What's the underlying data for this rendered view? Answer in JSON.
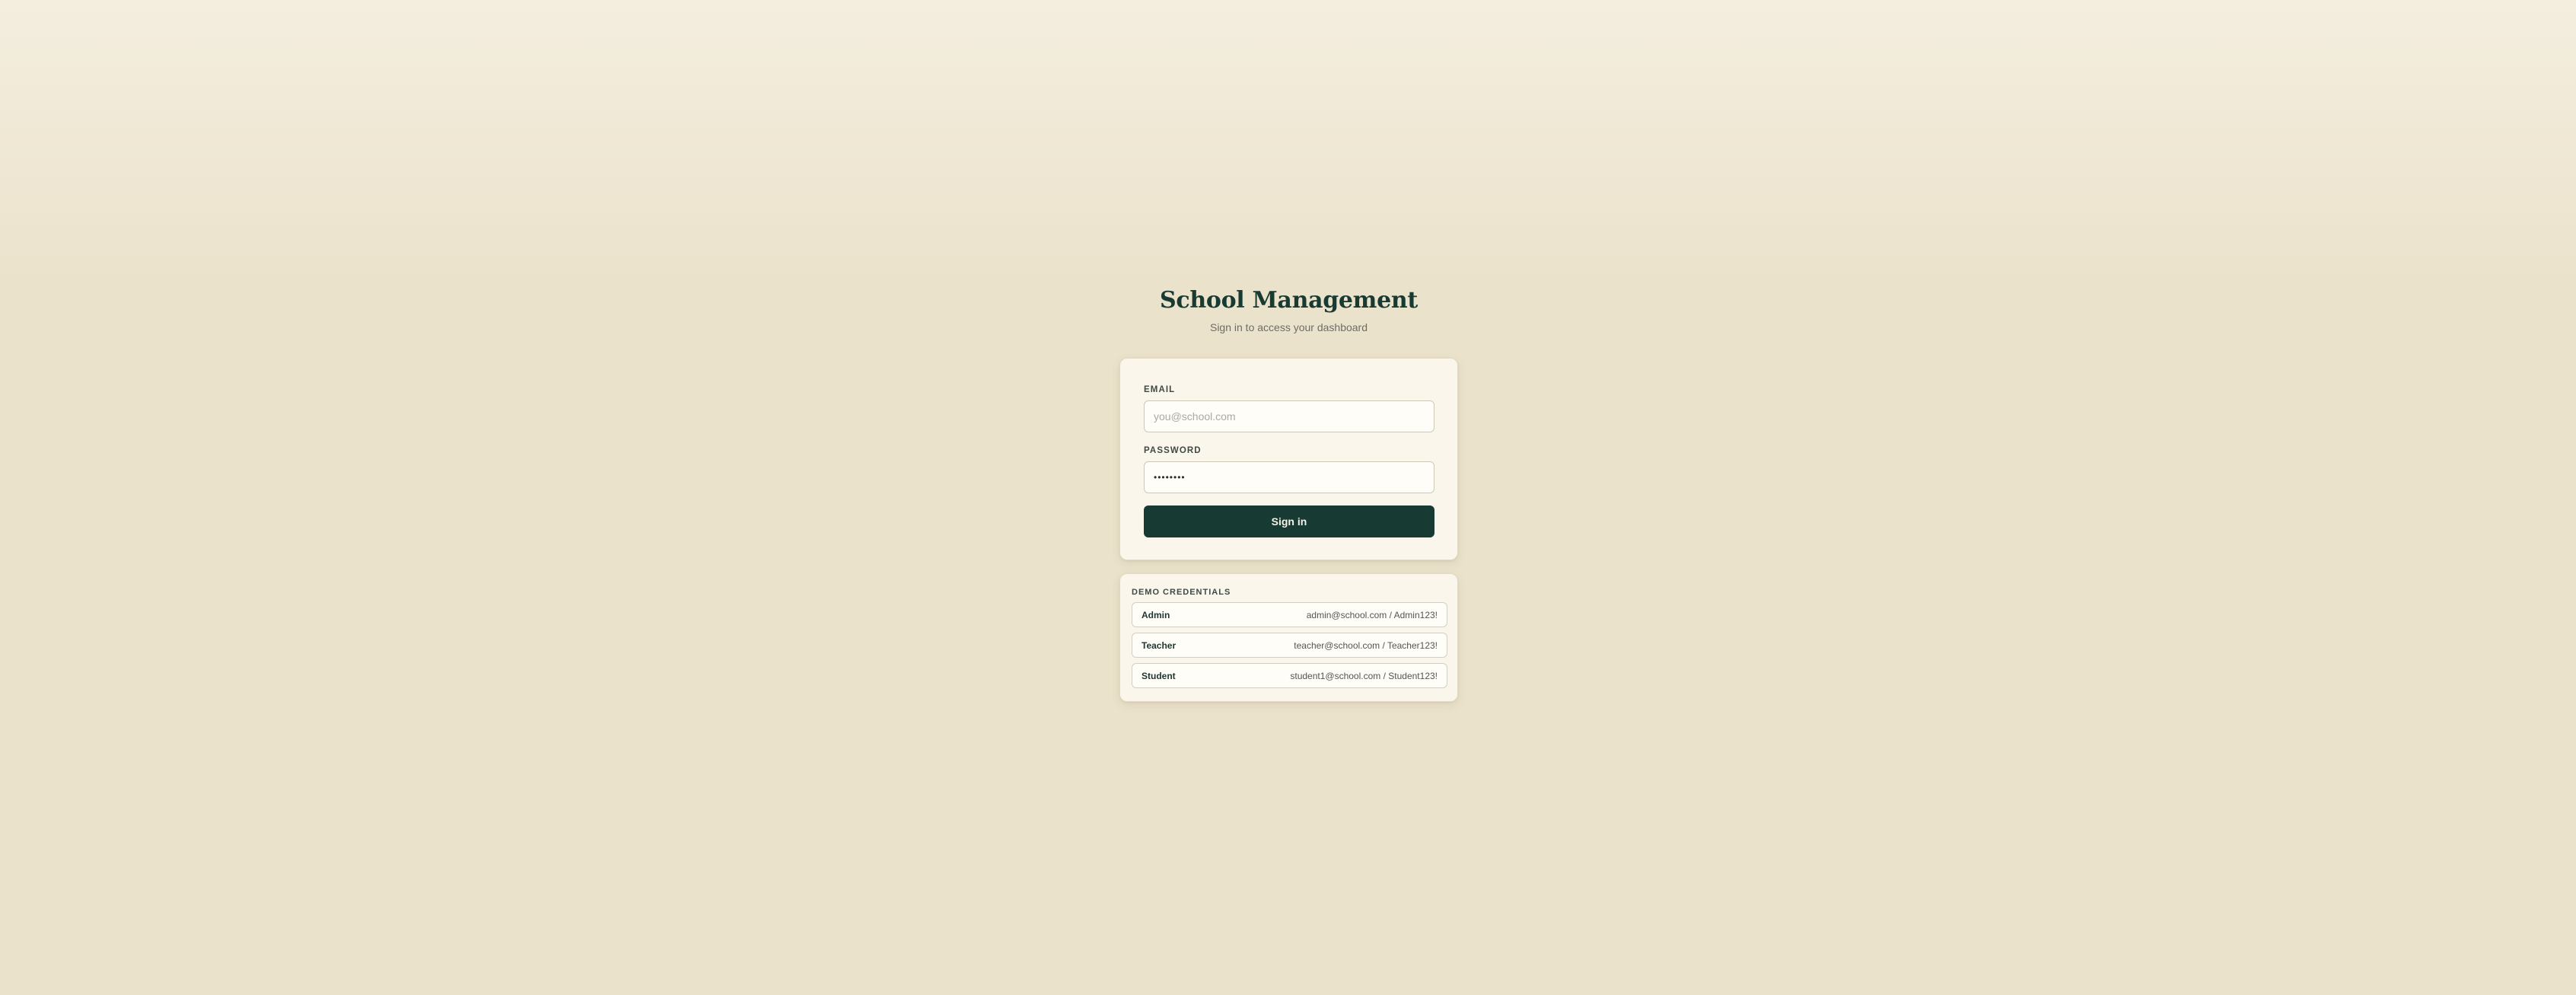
{
  "header": {
    "title": "School Management",
    "subtitle": "Sign in to access your dashboard"
  },
  "login": {
    "email_label": "EMAIL",
    "email_placeholder": "you@school.com",
    "email_value": "",
    "password_label": "PASSWORD",
    "password_value": "••••••••",
    "signin_label": "Sign in"
  },
  "demo": {
    "heading": "DEMO CREDENTIALS",
    "rows": [
      {
        "role": "Admin",
        "credentials": "admin@school.com / Admin123!"
      },
      {
        "role": "Teacher",
        "credentials": "teacher@school.com / Teacher123!"
      },
      {
        "role": "Student",
        "credentials": "student1@school.com / Student123!"
      }
    ]
  },
  "colors": {
    "background": "#ebe2cb",
    "card": "#faf6ec",
    "primary": "#173a33",
    "button_text": "#f6f1e6"
  }
}
